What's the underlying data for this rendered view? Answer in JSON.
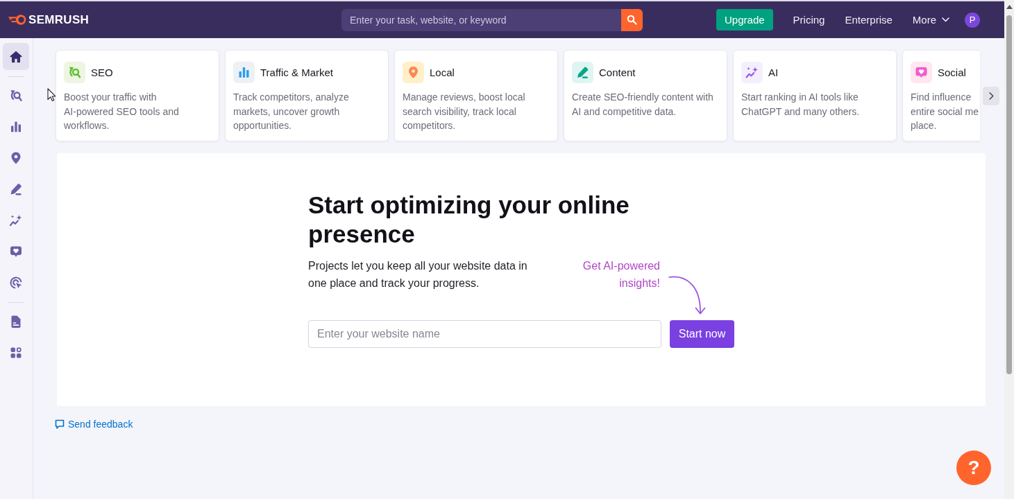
{
  "top_bar": {
    "logo": "SEMRUSH",
    "search": {
      "placeholder": "Enter your task, website, or keyword"
    },
    "upgrade_button": "Upgrade",
    "nav_links": [
      "Pricing",
      "Enterprise"
    ],
    "more_menu": "More",
    "avatar": "P"
  },
  "sidebar": {
    "groups": [
      [
        {
          "selected": true
        }
      ],
      [
        {
          "selected": false
        },
        {
          "selected": false
        },
        {
          "selected": false
        },
        {
          "selected": false
        },
        {
          "selected": false
        },
        {
          "selected": false
        },
        {
          "selected": false
        }
      ],
      [
        {
          "selected": false
        },
        {
          "selected": false
        }
      ]
    ]
  },
  "category_cards": [
    {
      "title": "SEO",
      "description": "Boost your traffic with\nAI-powered SEO tools and\nworkflows."
    },
    {
      "title": "Traffic & Market",
      "description": "Track competitors, analyze\nmarkets, uncover growth\nopportunities."
    },
    {
      "title": "Local",
      "description": "Manage reviews, boost local\nsearch visibility, track local\ncompetitors."
    },
    {
      "title": "Content",
      "description": "Create SEO-friendly content with\nAI and competitive data."
    },
    {
      "title": "AI",
      "description": "Start ranking in AI tools like\nChatGPT and many others."
    },
    {
      "title": "Social",
      "description": "Find influence\nentire social me\nplace."
    }
  ],
  "hero": {
    "heading": "Start optimizing your online presence",
    "text": "Projects let you keep all your website data in\none place and track your progress.",
    "callout": "Get AI-powered\ninsights!",
    "website_field": {
      "placeholder": "Enter your website name"
    },
    "start_button": "Start now"
  },
  "feedback_link": "Send feedback",
  "help_button": "?"
}
